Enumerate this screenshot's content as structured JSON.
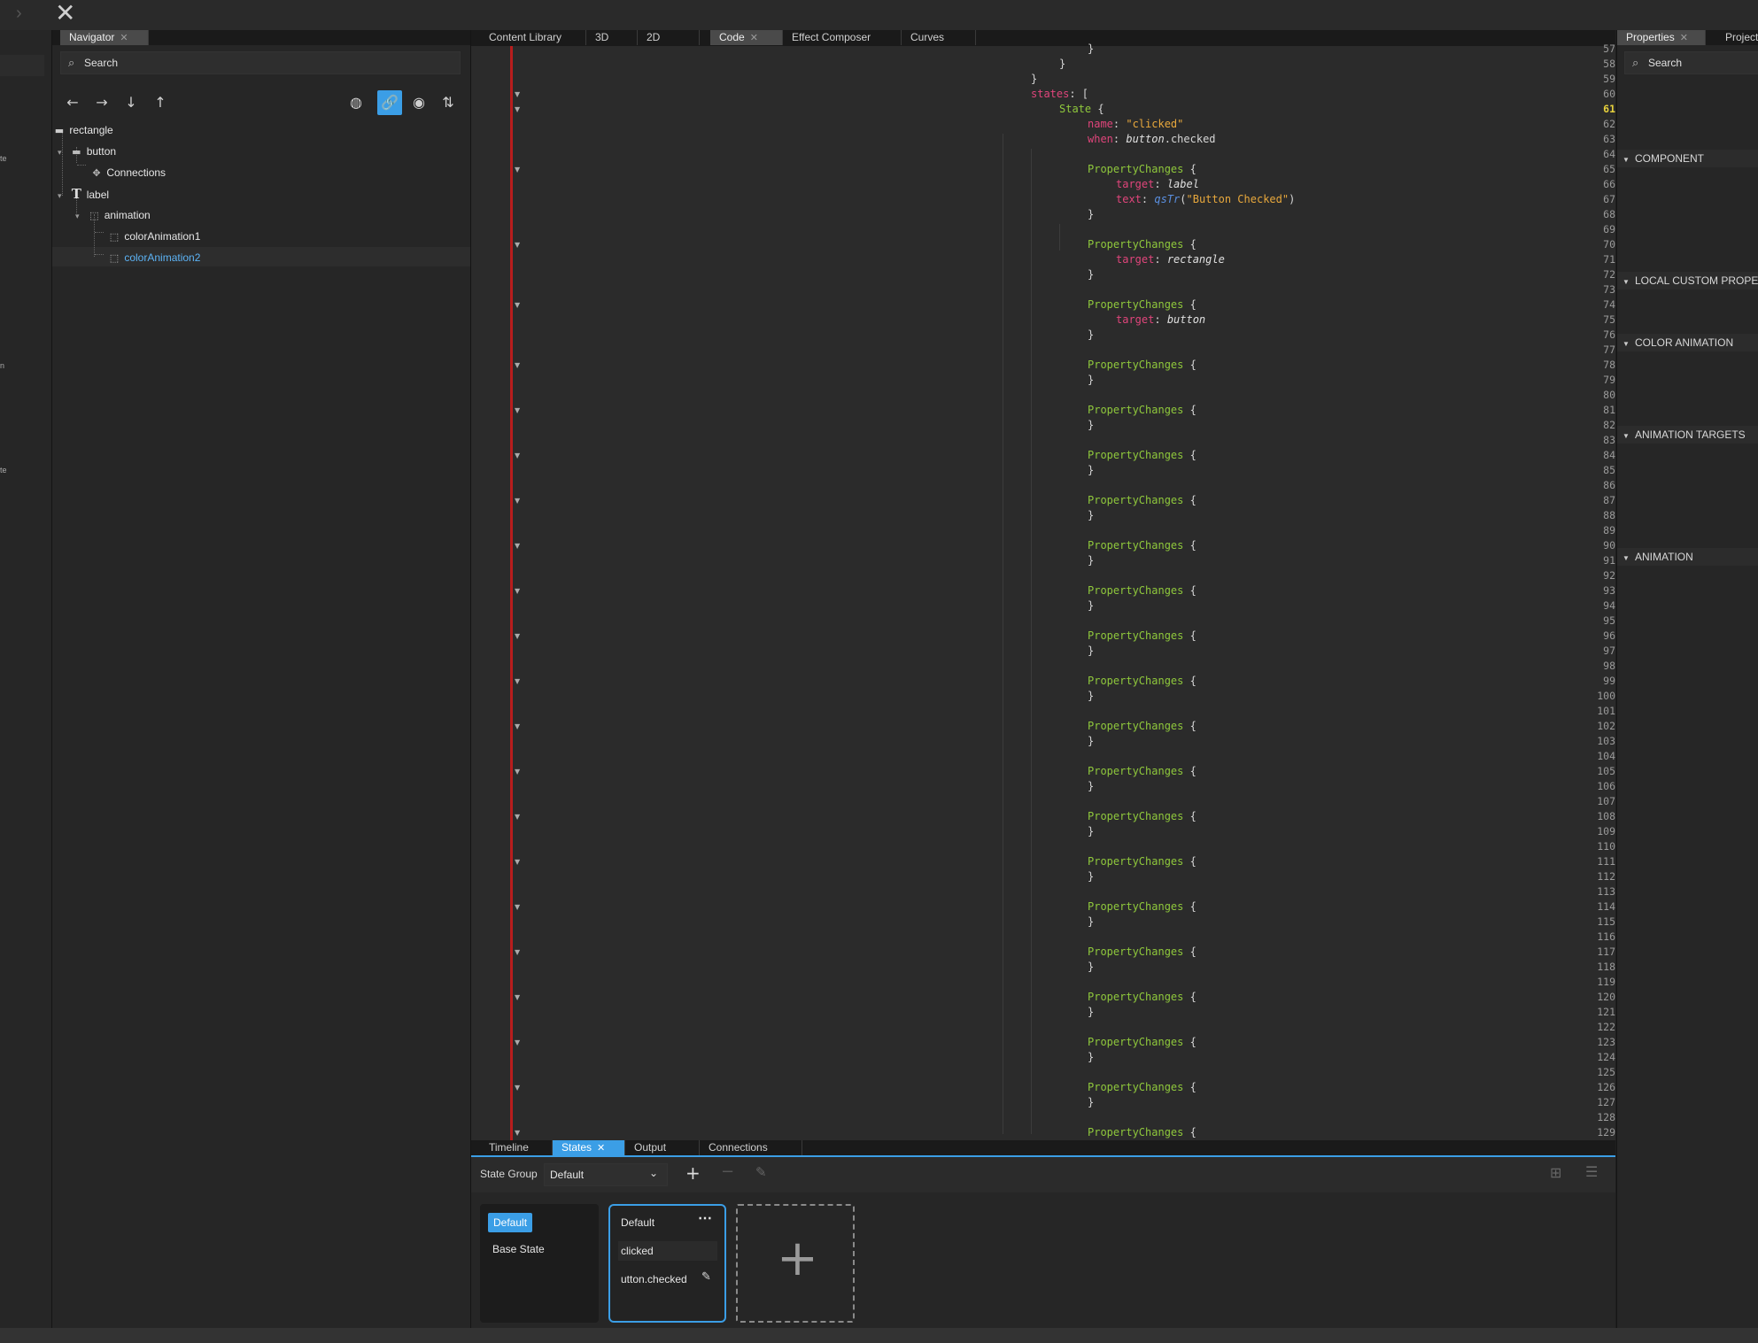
{
  "navigator": {
    "tab_label": "Navigator",
    "search_placeholder": "Search",
    "tree": [
      {
        "label": "rectangle",
        "icon": "rectangle-icon"
      },
      {
        "label": "button",
        "icon": "button-icon"
      },
      {
        "label": "Connections",
        "icon": "connections-icon"
      },
      {
        "label": "label",
        "icon": "text-icon"
      },
      {
        "label": "animation",
        "icon": "item-icon"
      },
      {
        "label": "colorAnimation1",
        "icon": "item-icon"
      },
      {
        "label": "colorAnimation2",
        "icon": "item-icon"
      }
    ]
  },
  "editor": {
    "tabs": [
      "Content Library",
      "3D",
      "2D",
      "Code",
      "Effect Composer",
      "Curves"
    ],
    "active_tab": "Code",
    "current_line": 61
  },
  "bottom": {
    "tabs": [
      "Timeline",
      "States",
      "Output",
      "Connections"
    ],
    "active_tab": "States",
    "state_group_label": "State Group",
    "state_group_value": "Default",
    "base_card": {
      "badge": "Default",
      "label": "Base State"
    },
    "state_card": {
      "badge": "Default",
      "name": "clicked",
      "when": "utton.checked"
    }
  },
  "properties": {
    "tabs": [
      "Properties",
      "Project"
    ],
    "search_placeholder": "Search",
    "sections": [
      "COMPONENT",
      "LOCAL CUSTOM PROPERTIES",
      "COLOR ANIMATION",
      "ANIMATION TARGETS",
      "ANIMATION"
    ]
  },
  "left_strip": {
    "fragments": [
      "te",
      "n",
      "te"
    ]
  },
  "colors": {
    "accent": "#3b9ee6",
    "keyword": "#e0457b",
    "type": "#8fc83c",
    "string": "#e8a83c",
    "gutter_marker": "#b81d1d"
  }
}
